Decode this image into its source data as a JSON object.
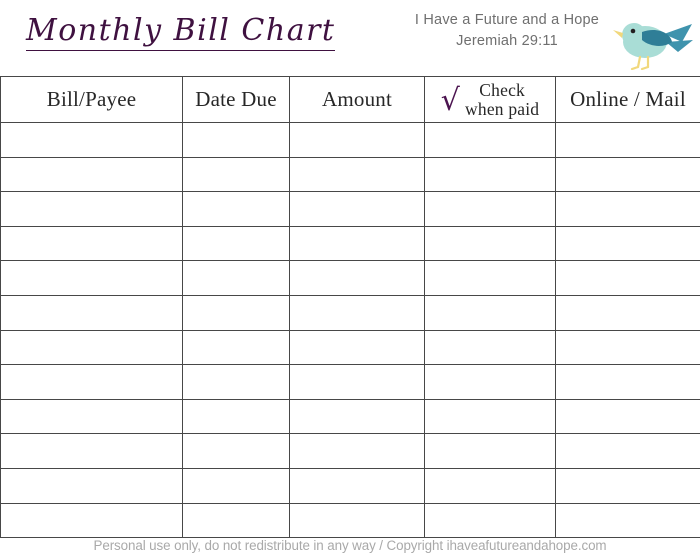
{
  "document": {
    "title": "Monthly Bill Chart",
    "title_color": "#3f1140",
    "tagline": "I Have a Future and a Hope",
    "verse_reference": "Jeremiah 29:11",
    "tagline_color": "#6f6f6f",
    "logo_icon": "bird-icon",
    "logo_colors": {
      "body": "#a9ddd6",
      "wing": "#2f7e97",
      "tail": "#3f93ad",
      "beak": "#f1d87c",
      "legs": "#f1d87c",
      "eye": "#231f20"
    },
    "footer": "Personal use only, do not redistribute in any way / Copyright ihaveafutureandahope.com",
    "footer_color": "#a9a9a9"
  },
  "table": {
    "grid_color": "#474747",
    "headers": [
      {
        "key": "bill_payee",
        "label": "Bill/Payee"
      },
      {
        "key": "date_due",
        "label": "Date Due"
      },
      {
        "key": "amount",
        "label": "Amount"
      },
      {
        "key": "check_when_paid",
        "label_line1": "Check",
        "label_line2": "when paid",
        "icon": "checkmark-icon",
        "icon_glyph": "√",
        "icon_color": "#4c1450"
      },
      {
        "key": "online_mail",
        "label": "Online / Mail"
      }
    ],
    "row_count": 12,
    "rows": [
      {
        "bill_payee": "",
        "date_due": "",
        "amount": "",
        "check_when_paid": "",
        "online_mail": ""
      },
      {
        "bill_payee": "",
        "date_due": "",
        "amount": "",
        "check_when_paid": "",
        "online_mail": ""
      },
      {
        "bill_payee": "",
        "date_due": "",
        "amount": "",
        "check_when_paid": "",
        "online_mail": ""
      },
      {
        "bill_payee": "",
        "date_due": "",
        "amount": "",
        "check_when_paid": "",
        "online_mail": ""
      },
      {
        "bill_payee": "",
        "date_due": "",
        "amount": "",
        "check_when_paid": "",
        "online_mail": ""
      },
      {
        "bill_payee": "",
        "date_due": "",
        "amount": "",
        "check_when_paid": "",
        "online_mail": ""
      },
      {
        "bill_payee": "",
        "date_due": "",
        "amount": "",
        "check_when_paid": "",
        "online_mail": ""
      },
      {
        "bill_payee": "",
        "date_due": "",
        "amount": "",
        "check_when_paid": "",
        "online_mail": ""
      },
      {
        "bill_payee": "",
        "date_due": "",
        "amount": "",
        "check_when_paid": "",
        "online_mail": ""
      },
      {
        "bill_payee": "",
        "date_due": "",
        "amount": "",
        "check_when_paid": "",
        "online_mail": ""
      },
      {
        "bill_payee": "",
        "date_due": "",
        "amount": "",
        "check_when_paid": "",
        "online_mail": ""
      },
      {
        "bill_payee": "",
        "date_due": "",
        "amount": "",
        "check_when_paid": "",
        "online_mail": ""
      }
    ]
  }
}
